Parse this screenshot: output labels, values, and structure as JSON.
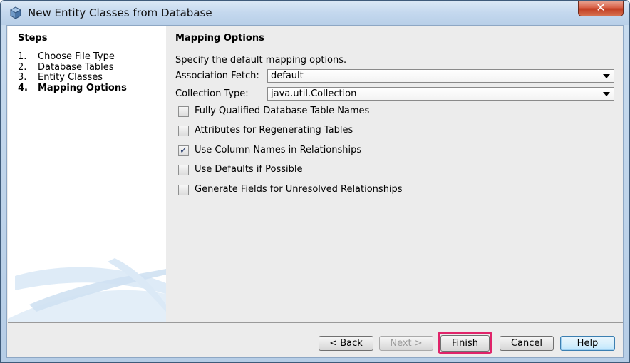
{
  "window": {
    "title": "New Entity Classes from Database",
    "close_glyph": "✕"
  },
  "steps": {
    "title": "Steps",
    "items": [
      {
        "num": "1.",
        "label": "Choose File Type"
      },
      {
        "num": "2.",
        "label": "Database Tables"
      },
      {
        "num": "3.",
        "label": "Entity Classes"
      },
      {
        "num": "4.",
        "label": "Mapping Options"
      }
    ],
    "current_index": 3
  },
  "mapping": {
    "title": "Mapping Options",
    "description": "Specify the default mapping options.",
    "association_fetch": {
      "label": "Association Fetch:",
      "value": "default"
    },
    "collection_type": {
      "label": "Collection Type:",
      "value": "java.util.Collection"
    },
    "options": [
      {
        "label": "Fully Qualified Database Table Names",
        "checked": false
      },
      {
        "label": "Attributes for Regenerating Tables",
        "checked": false
      },
      {
        "label": "Use Column Names in Relationships",
        "checked": true
      },
      {
        "label": "Use Defaults if Possible",
        "checked": false
      },
      {
        "label": "Generate Fields for Unresolved Relationships",
        "checked": false
      }
    ]
  },
  "buttons": {
    "back": "< Back",
    "next": "Next >",
    "finish": "Finish",
    "cancel": "Cancel",
    "help": "Help"
  },
  "colors": {
    "highlight": "#e0246a",
    "title_bar": "#c4d8ee"
  },
  "checkmark": "✓"
}
